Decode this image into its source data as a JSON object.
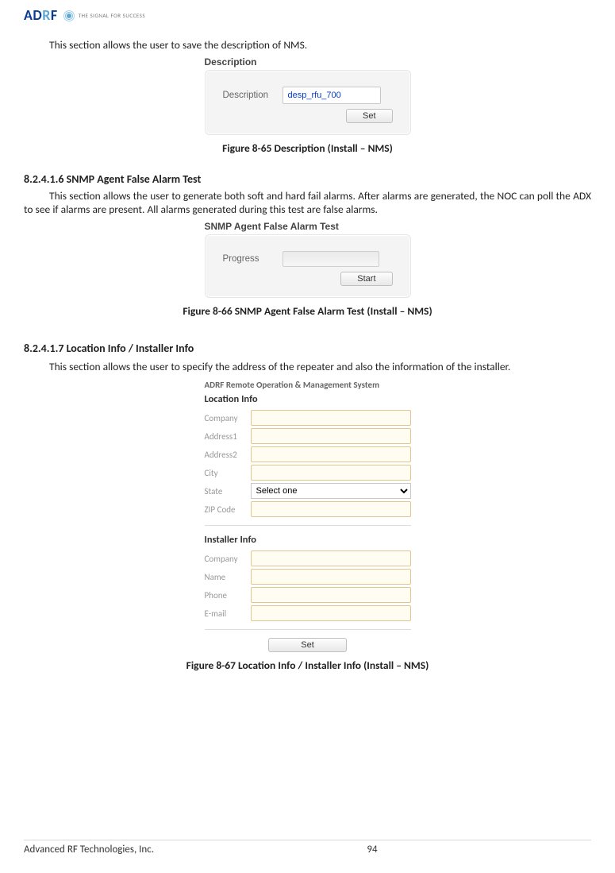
{
  "logo": {
    "tagline": "THE SIGNAL FOR SUCCESS"
  },
  "intro_text": "This section allows the user to save the description of NMS.",
  "fig65": {
    "panel_title": "Description",
    "label": "Description",
    "value": "desp_rfu_700",
    "button": "Set",
    "caption": "Figure 8-65    Description (Install – NMS)"
  },
  "sec1": {
    "heading": "8.2.4.1.6    SNMP Agent False Alarm Test",
    "text": "This section allows the user to generate both soft and hard fail alarms.   After alarms are generated, the NOC can poll the ADX to see if alarms are present.  All alarms generated during this test are false alarms."
  },
  "fig66": {
    "panel_title": "SNMP Agent False Alarm Test",
    "label": "Progress",
    "button": "Start",
    "caption": "Figure 8-66    SNMP Agent False Alarm Test (Install – NMS)"
  },
  "sec2": {
    "heading": "8.2.4.1.7    Location Info / Installer Info",
    "text": "This section allows the user to specify the address of the repeater and also the information of the installer."
  },
  "fig67": {
    "header": "ADRF Remote Operation & Management System",
    "location_title": "Location Info",
    "loc_fields": {
      "company": "Company",
      "address1": "Address1",
      "address2": "Address2",
      "city": "City",
      "state": "State",
      "state_placeholder": "Select one",
      "zip": "ZIP Code"
    },
    "installer_title": "Installer Info",
    "inst_fields": {
      "company": "Company",
      "name": "Name",
      "phone": "Phone",
      "email": "E-mail"
    },
    "button": "Set",
    "caption": "Figure 8-67    Location Info / Installer Info (Install – NMS)"
  },
  "footer": {
    "company": "Advanced RF Technologies, Inc.",
    "page": "94"
  }
}
